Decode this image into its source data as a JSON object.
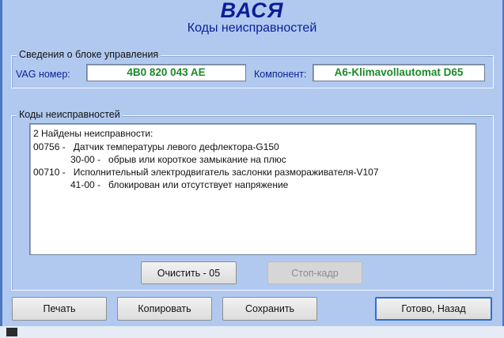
{
  "header": {
    "title": "ВАСЯ",
    "subtitle": "Коды неисправностей"
  },
  "controller_info": {
    "legend": "Сведения о блоке управления",
    "vag_label": "VAG номер:",
    "vag_value": "4B0 820 043 AE",
    "component_label": "Компонент:",
    "component_value": "A6-Klimavollautomat D65"
  },
  "fault_codes": {
    "legend": "Коды неисправностей",
    "lines": [
      "2 Найдены неисправности:",
      "00756 -   Датчик температуры левого дефлектора-G150",
      "30-00 -   обрыв или короткое замыкание на плюс",
      "00710 -   Исполнительный электродвигатель заслонки размораживателя-V107",
      "41-00 -   блокирован или отсутствует напряжение"
    ]
  },
  "buttons": {
    "clear": "Очистить - 05",
    "freeze_frame": "Стоп-кадр",
    "print": "Печать",
    "copy": "Копировать",
    "save": "Сохранить",
    "done": "Готово, Назад"
  },
  "colors": {
    "background": "#b1c9ef",
    "title": "#0b1e96",
    "value_text": "#1a8a2a"
  }
}
